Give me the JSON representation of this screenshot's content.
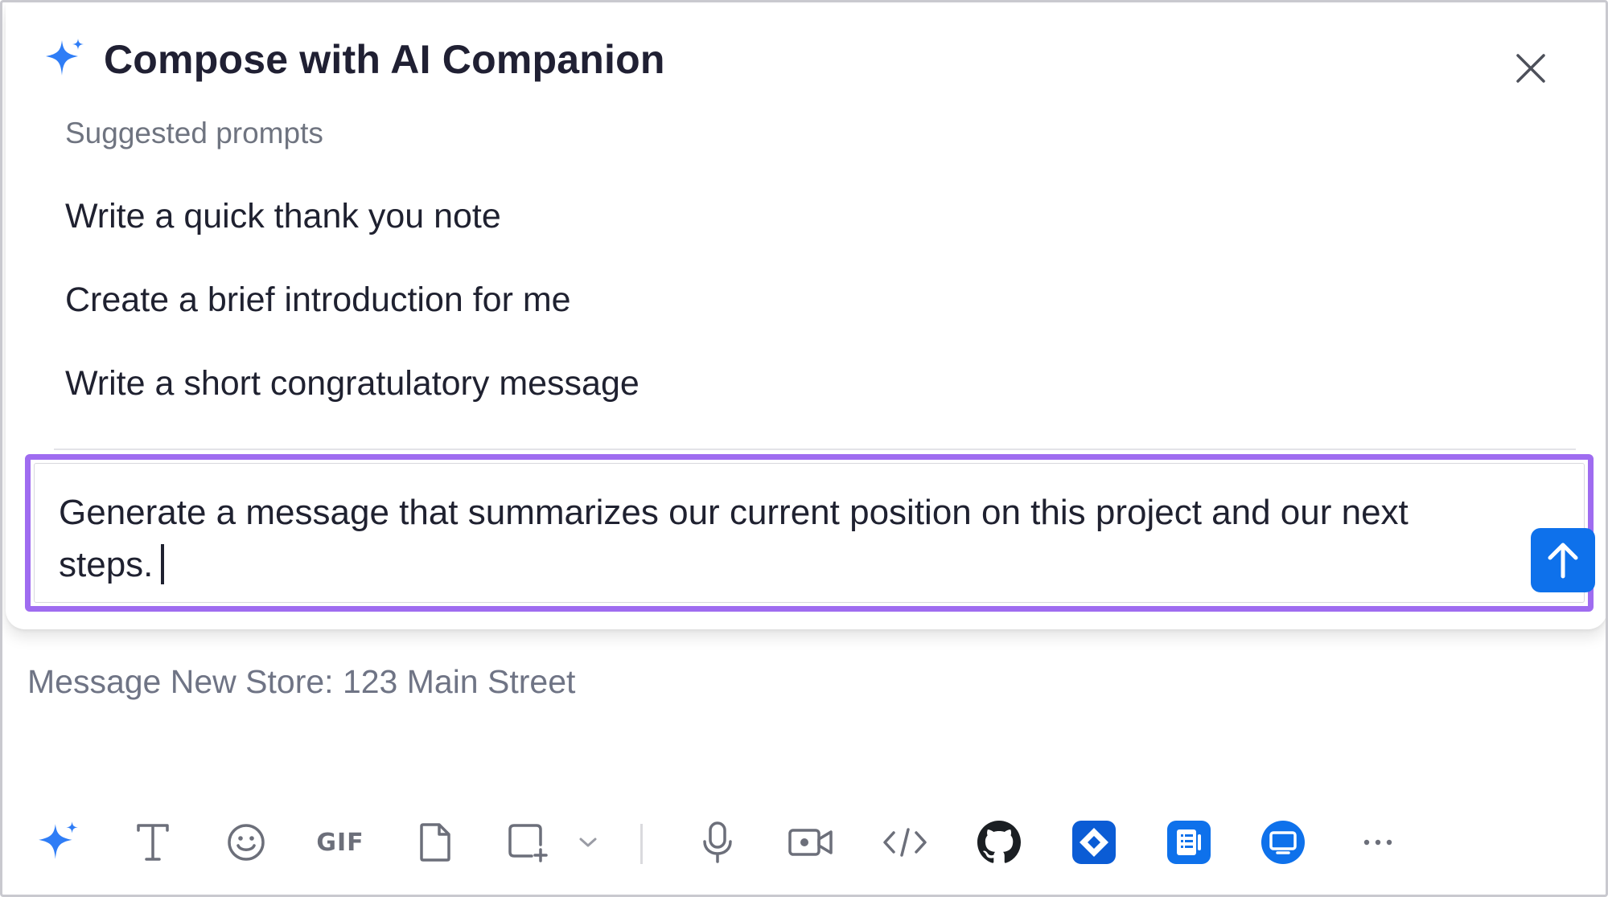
{
  "ai_panel": {
    "title": "Compose with AI Companion",
    "suggested_label": "Suggested prompts",
    "prompts": [
      "Write a quick thank you note",
      "Create a brief introduction for me",
      "Write a short congratulatory message"
    ],
    "compose_text": "Generate a message that summarizes our current position on this project and our next steps.",
    "sparkle_icon": "sparkle-icon",
    "close_icon": "close-icon",
    "send_icon": "arrow-up-icon"
  },
  "message": {
    "placeholder": "Message New Store: 123 Main Street"
  },
  "toolbar": {
    "gif_label": "GIF",
    "icons": [
      "ai-companion-icon",
      "text-format-icon",
      "emoji-icon",
      "gif-icon",
      "file-icon",
      "screenshot-icon",
      "chevron-down-icon",
      "microphone-icon",
      "video-clip-icon",
      "code-snippet-icon",
      "github-icon",
      "jira-icon",
      "notes-app-icon",
      "whiteboard-app-icon",
      "more-icon"
    ]
  },
  "colors": {
    "accent_purple": "#9f6cf0",
    "send_blue": "#0e71eb",
    "sparkle_blue": "#2f7df6",
    "jira_blue": "#0b5cd5",
    "app_blue": "#0e71eb",
    "icon_gray": "#6c6f7a"
  }
}
